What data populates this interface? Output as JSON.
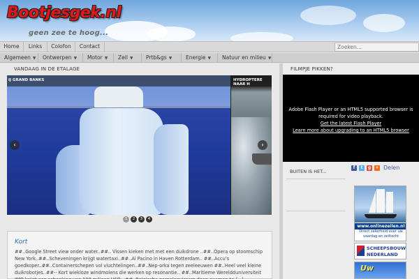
{
  "header": {
    "logo": "Bootjesgek.nl",
    "tagline": "geen zee te hoog...",
    "colors": {
      "logo": "#e01818",
      "sky": "#6fa6dd"
    }
  },
  "topnav": {
    "items": [
      "Home",
      "Links",
      "Colofon",
      "Contact"
    ],
    "search_placeholder": "Zoeken..."
  },
  "catnav": {
    "items": [
      "Algemeen",
      "Ontwerpen",
      "Motor",
      "Zeil",
      "Prtb&gs",
      "Energie",
      "Natuur en milieu"
    ],
    "arrow_icon": "chevron-down-icon"
  },
  "main": {
    "section_title": "VANDAAG IN DE ETALAGE",
    "slider": {
      "slide1_label": "IJ GRAND BANKS",
      "slide2_label": "HYDROPTERE NAAR H",
      "prev_icon": "arrow-left-icon",
      "next_icon": "arrow-right-icon",
      "pages": [
        "1",
        "2",
        "3",
        "4"
      ],
      "active_page": 1
    },
    "article": {
      "title": "Kort",
      "body": "##..Google Street view onder water..##.. Vissen kieken met met een duikdrone ..##..Opera op stoomschip New York..##..Scheveningen krijgt watertaxi..##..Al Pacino in Haven Rotterdam.. ##..Accu's goedkoper..##..Containerschepen vol vluchtelingen..##..Nep-orka tegen zeeleeuwen ##..Heel veel kleine duikrobotjes..##-- Kort wiekloze windmolens die werken op resonantie.. ##..Maritieme Wereldduniversiteit IMO krijgt een schenking van 100 miljoen USD ..##..Belgische garnalenvissers doen examen te",
      "more": "[...]"
    }
  },
  "sidebar": {
    "video_title": "FILMPJE PIKKEN?",
    "video": {
      "line1": "Adobe Flash Player or an HTML5 supported browser is",
      "line2": "required for video playback.",
      "link1": "Get the latest Flash Player",
      "link2": "Learn more about upgrading to an HTML5 browser"
    },
    "buiten_title": "BUITEN IS HET...",
    "share": {
      "label": "Delen",
      "icons": [
        "facebook-icon",
        "twitter-icon",
        "googleplus-icon",
        "plus-icon"
      ]
    },
    "ads": {
      "ad1_line1": "www.onlinezeilen.nl",
      "ad1_line2": "Direct zekerheid over uw",
      "ad1_line3": "vaardag en zeiltocht",
      "ad2_line1": "SCHEEPSBOUW",
      "ad2_line2": "NEDERLAND",
      "ad3_text": "Uw"
    }
  }
}
